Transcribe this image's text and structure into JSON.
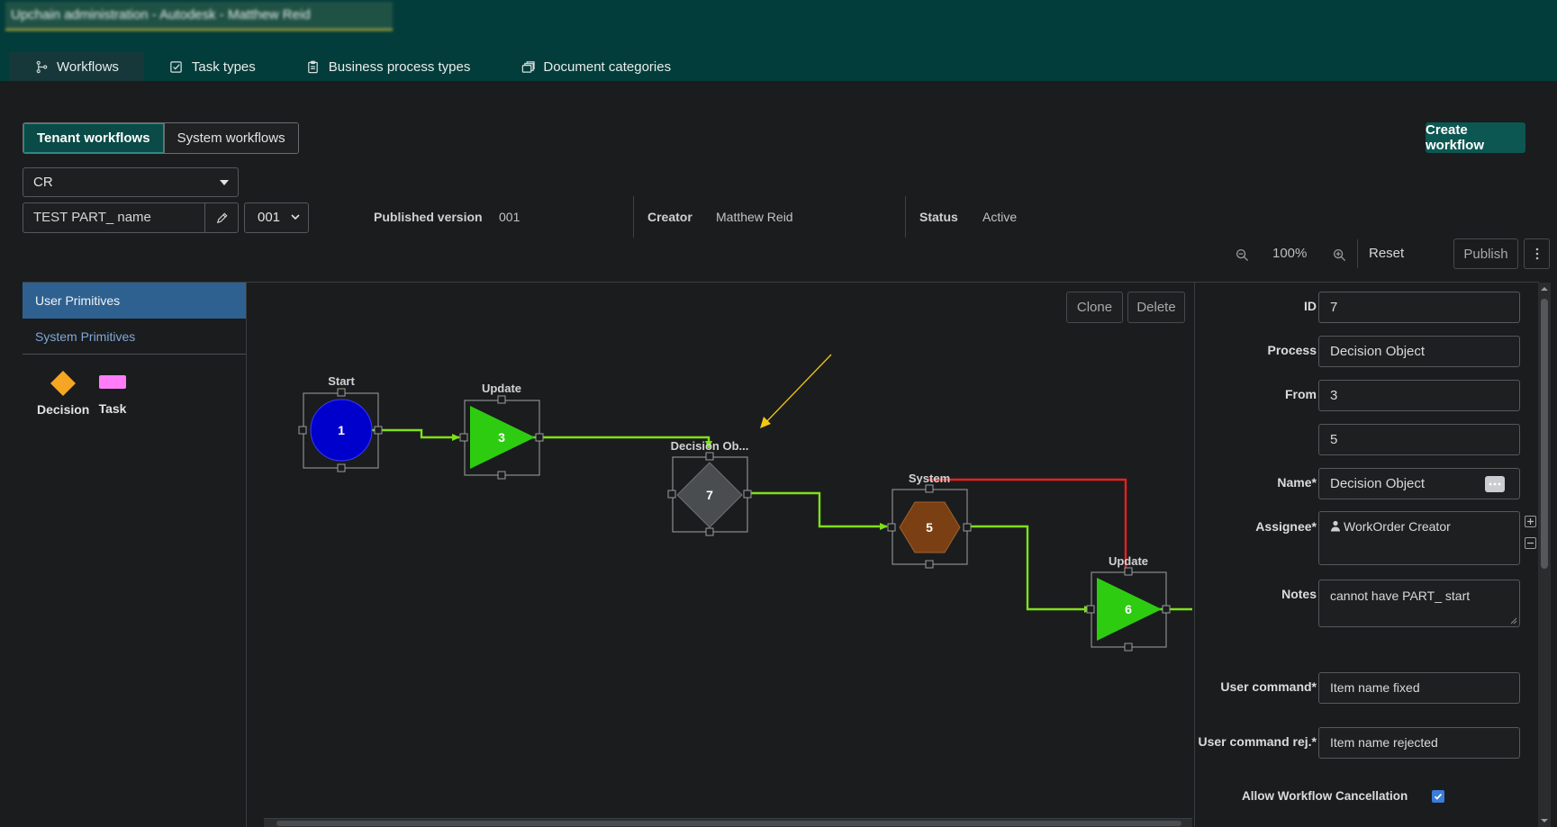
{
  "header": {
    "title": "Upchain administration - Autodesk - Matthew Reid",
    "tabs": [
      {
        "label": "Workflows",
        "icon": "workflow-icon",
        "active": true
      },
      {
        "label": "Task types",
        "icon": "checkbox-icon"
      },
      {
        "label": "Business process types",
        "icon": "clipboard-icon"
      },
      {
        "label": "Document categories",
        "icon": "folders-icon"
      }
    ]
  },
  "workflow_toggle": {
    "tenant": "Tenant workflows",
    "system": "System workflows",
    "selected": "Tenant workflows"
  },
  "create_workflow": "Create workflow",
  "category_select": {
    "value": "CR"
  },
  "workflow_name": {
    "value": "TEST PART_ name"
  },
  "version_select": {
    "value": "001"
  },
  "meta": {
    "published_label": "Published version",
    "published_value": "001",
    "creator_label": "Creator",
    "creator_value": "Matthew Reid",
    "status_label": "Status",
    "status_value": "Active"
  },
  "toolbar": {
    "zoom": "100%",
    "reset": "Reset",
    "publish": "Publish"
  },
  "palette": {
    "tabs": [
      "User Primitives",
      "System Primitives"
    ],
    "items": [
      {
        "label": "Decision",
        "color": "#f5a623",
        "icon": "diamond-shape-icon"
      },
      {
        "label": "Task",
        "color": "#ff7ef7",
        "icon": "rectangle-shape-icon"
      }
    ]
  },
  "canvas": {
    "clone": "Clone",
    "delete": "Delete",
    "nodes": [
      {
        "id": "1",
        "title": "Start",
        "shape": "circle",
        "color": "#0000cc"
      },
      {
        "id": "3",
        "title": "Update",
        "shape": "triangle",
        "color": "#2ecc11"
      },
      {
        "id": "7",
        "title": "Decision Ob...",
        "shape": "diamond",
        "color": "#4a4d50"
      },
      {
        "id": "5",
        "title": "System",
        "shape": "hexagon",
        "color": "#7a3f12"
      },
      {
        "id": "6",
        "title": "Update",
        "shape": "triangle",
        "color": "#2ecc11"
      }
    ],
    "link_color": "#7fe01a",
    "reject_link_color": "#e82020",
    "annotation_color": "#f2c811"
  },
  "properties": {
    "id_label": "ID",
    "id_value": "7",
    "process_label": "Process",
    "process_value": "Decision Object",
    "from_label": "From",
    "from_value": "3",
    "to_value": "5",
    "name_label": "Name*",
    "name_value": "Decision Object",
    "assignee_label": "Assignee*",
    "assignee_value": "WorkOrder Creator",
    "notes_label": "Notes",
    "notes_value": "cannot have PART_ start",
    "user_command_label": "User command*",
    "user_command_value": "Item name fixed",
    "user_command_rej_label": "User command rej.*",
    "user_command_rej_value": "Item name rejected",
    "allow_cancel_label": "Allow Workflow Cancellation",
    "allow_cancel_checked": true
  }
}
